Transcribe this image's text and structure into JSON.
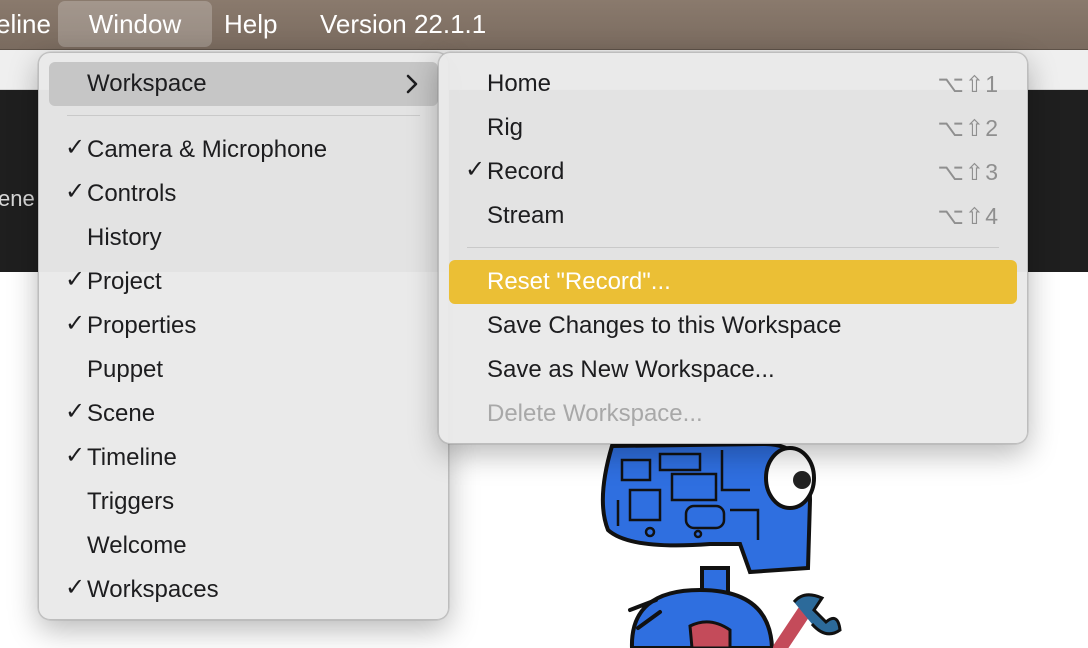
{
  "menubar": {
    "items": [
      {
        "label": "eline"
      },
      {
        "label": "Window"
      },
      {
        "label": "Help"
      },
      {
        "label": "Version 22.1.1"
      }
    ]
  },
  "background": {
    "panel_label": "ene"
  },
  "window_menu": {
    "items": [
      {
        "label": "Workspace",
        "checked": false
      },
      {
        "label": "Camera & Microphone",
        "checked": true
      },
      {
        "label": "Controls",
        "checked": true
      },
      {
        "label": "History",
        "checked": false
      },
      {
        "label": "Project",
        "checked": true
      },
      {
        "label": "Properties",
        "checked": true
      },
      {
        "label": "Puppet",
        "checked": false
      },
      {
        "label": "Scene",
        "checked": true
      },
      {
        "label": "Timeline",
        "checked": true
      },
      {
        "label": "Triggers",
        "checked": false
      },
      {
        "label": "Welcome",
        "checked": false
      },
      {
        "label": "Workspaces",
        "checked": true
      }
    ]
  },
  "workspace_submenu": {
    "items": [
      {
        "label": "Home",
        "shortcut": "⌥⇧1",
        "checked": false
      },
      {
        "label": "Rig",
        "shortcut": "⌥⇧2",
        "checked": false
      },
      {
        "label": "Record",
        "shortcut": "⌥⇧3",
        "checked": true
      },
      {
        "label": "Stream",
        "shortcut": "⌥⇧4",
        "checked": false
      }
    ],
    "actions": [
      {
        "label": "Reset \"Record\"..."
      },
      {
        "label": "Save Changes to this Workspace"
      },
      {
        "label": "Save as New Workspace..."
      },
      {
        "label": "Delete Workspace..."
      }
    ]
  },
  "check_glyph": "✓",
  "colors": {
    "highlight": "#ebbf35",
    "menubar": "#7f6f63",
    "robot_blue": "#2f6fe0"
  }
}
